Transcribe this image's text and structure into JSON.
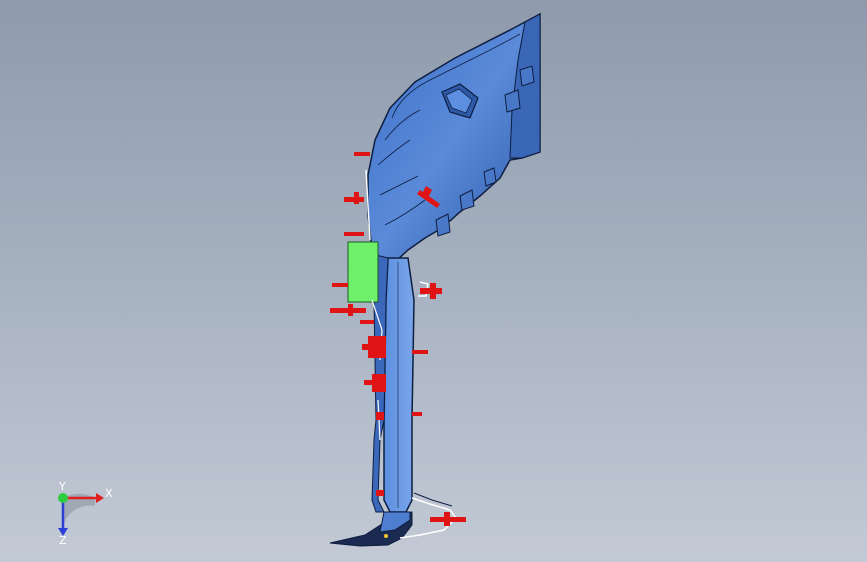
{
  "viewport": {
    "background_top": "#8f9bac",
    "background_bottom": "#c3cad6"
  },
  "model": {
    "part_color": "#4f7ed0",
    "part_edge_color": "#0d1e40",
    "pin_color": "#e01414",
    "block_color": "#6ef06a",
    "rib_color": "#ffffff"
  },
  "triad": {
    "x_label": "X",
    "y_label": "Y",
    "z_label": "Z",
    "x_color": "#e02020",
    "y_color": "#2ecc40",
    "z_color": "#2b3fd8"
  }
}
